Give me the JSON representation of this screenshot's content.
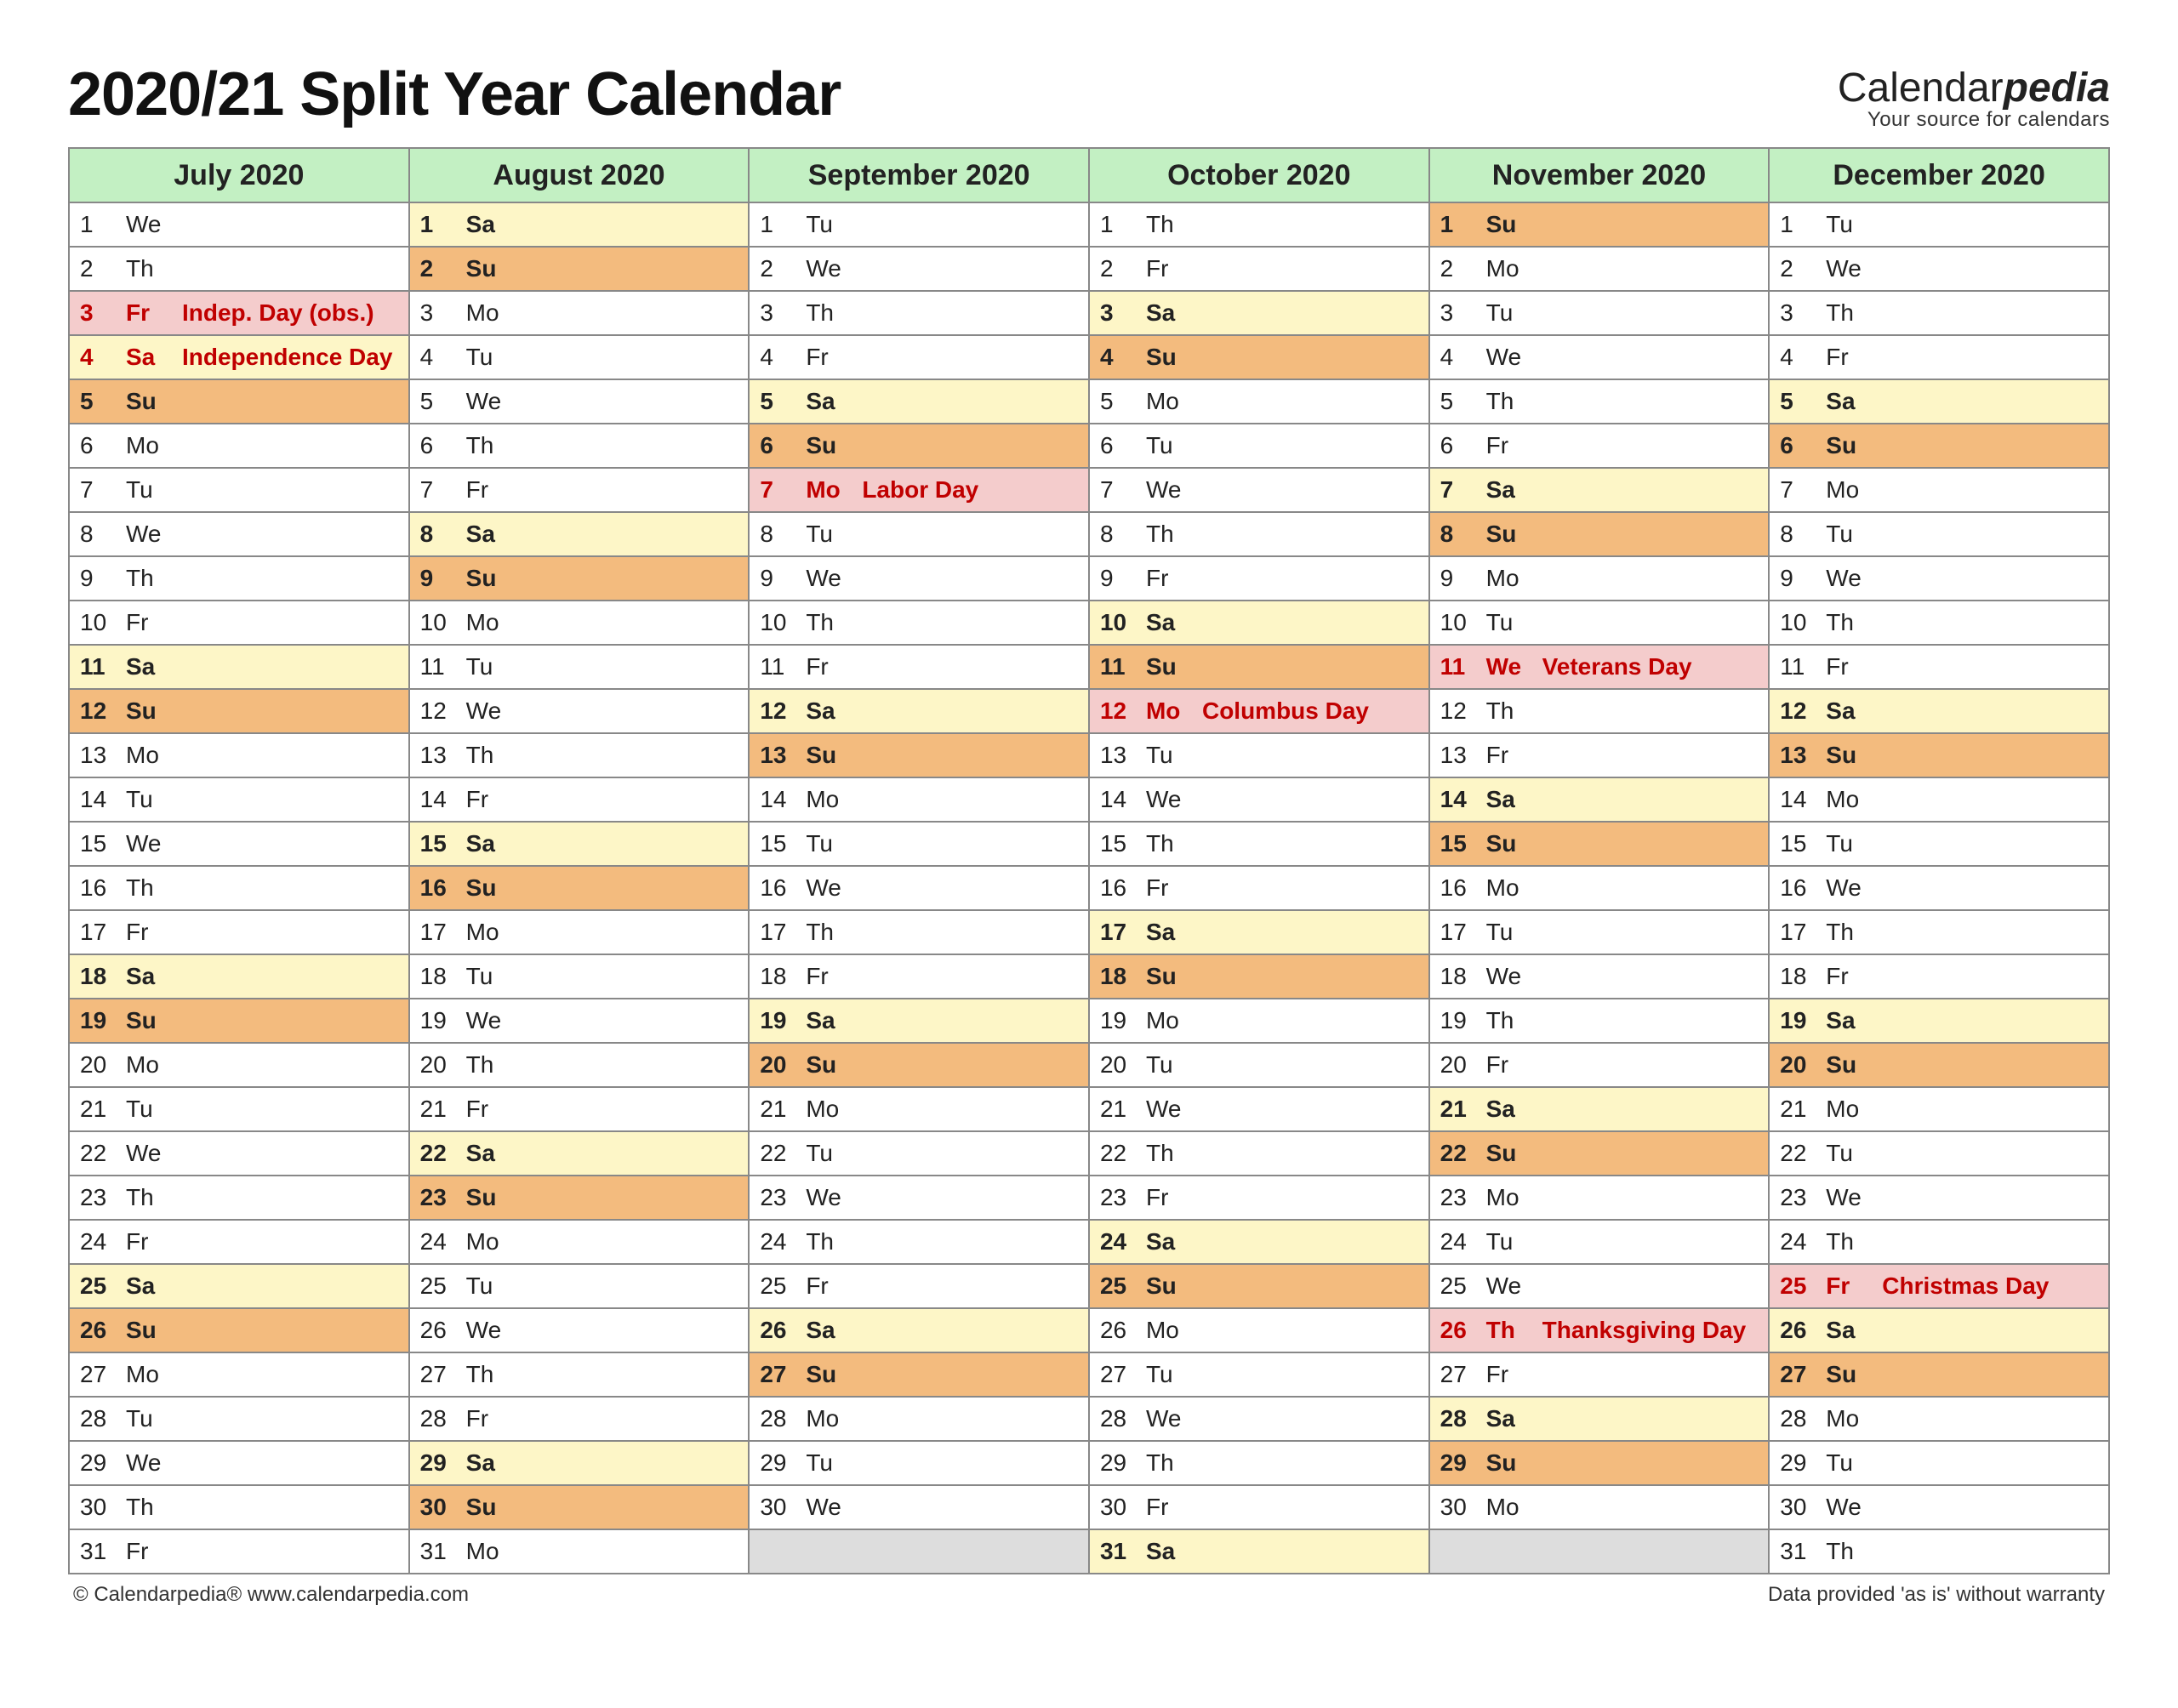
{
  "title": "2020/21 Split Year Calendar",
  "brand": {
    "name1": "Calendar",
    "name2": "pedia",
    "tagline": "Your source for calendars"
  },
  "footer": {
    "left": "© Calendarpedia®   www.calendarpedia.com",
    "right": "Data provided 'as is' without warranty"
  },
  "dows": [
    "Su",
    "Mo",
    "Tu",
    "We",
    "Th",
    "Fr",
    "Sa"
  ],
  "months": [
    {
      "label": "July 2020",
      "start": 3,
      "len": 31,
      "holidays": {
        "3": "Indep. Day (obs.)",
        "4": "Independence Day"
      }
    },
    {
      "label": "August 2020",
      "start": 6,
      "len": 31,
      "holidays": {}
    },
    {
      "label": "September 2020",
      "start": 2,
      "len": 30,
      "holidays": {
        "7": "Labor Day"
      }
    },
    {
      "label": "October 2020",
      "start": 4,
      "len": 31,
      "holidays": {
        "12": "Columbus Day"
      }
    },
    {
      "label": "November 2020",
      "start": 0,
      "len": 30,
      "holidays": {
        "11": "Veterans Day",
        "26": "Thanksgiving Day"
      }
    },
    {
      "label": "December 2020",
      "start": 2,
      "len": 31,
      "holidays": {
        "25": "Christmas Day"
      }
    }
  ]
}
